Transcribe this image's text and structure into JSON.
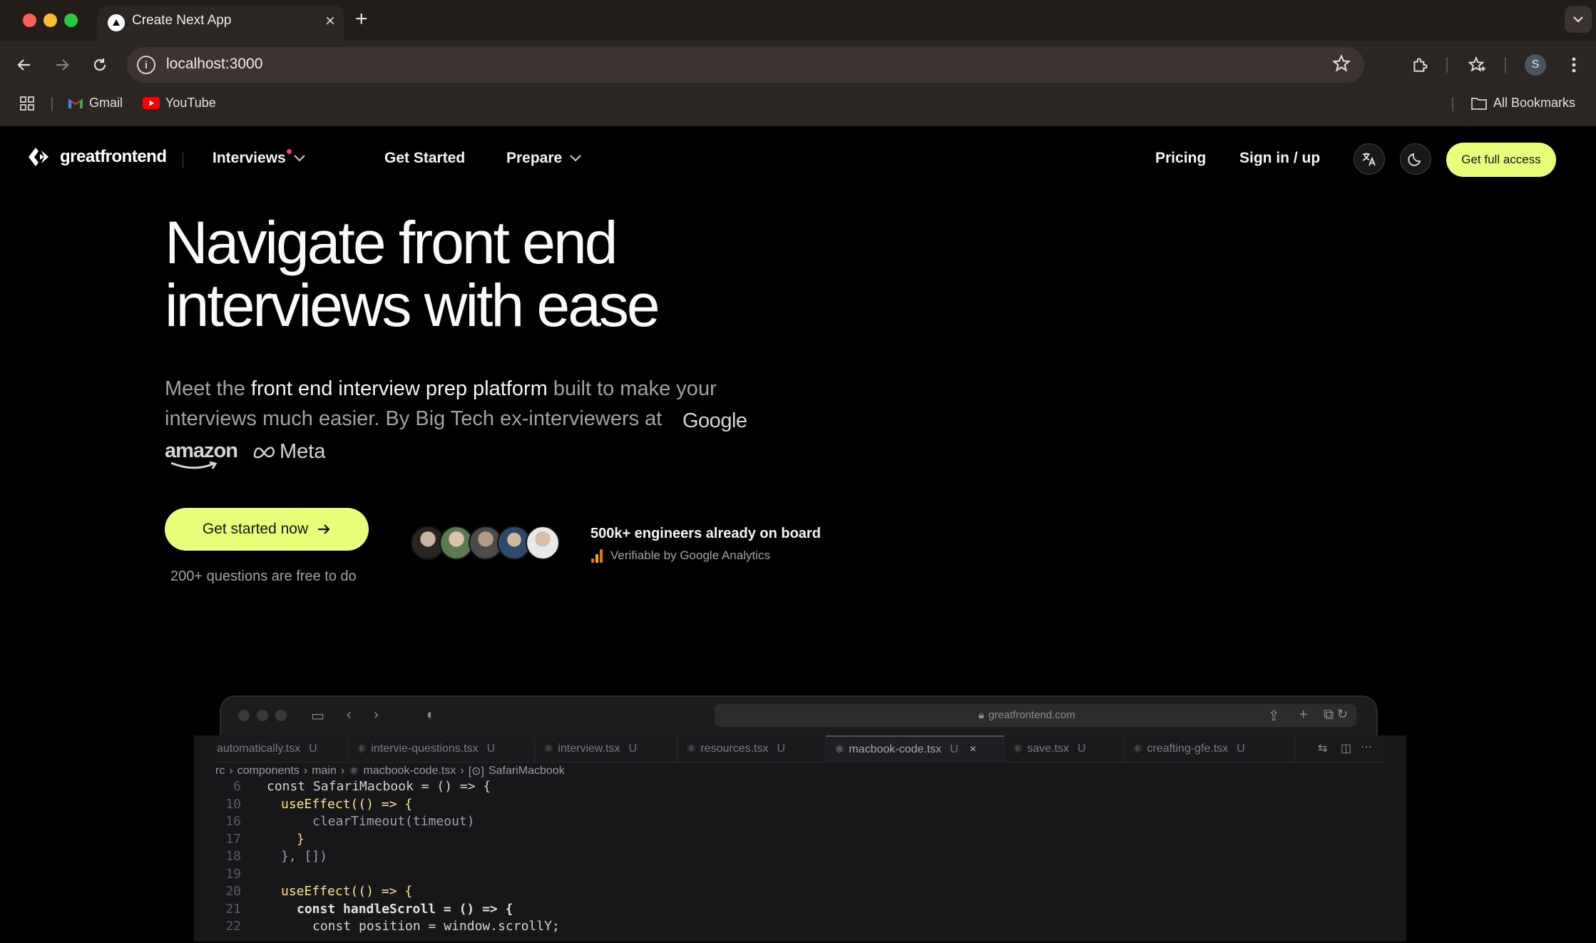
{
  "browser": {
    "tab_title": "Create Next App",
    "url": "localhost:3000",
    "profile_initial": "S",
    "bookmarks": [
      {
        "label": "Gmail",
        "icon": "gmail-icon"
      },
      {
        "label": "YouTube",
        "icon": "youtube-icon"
      }
    ],
    "all_bookmarks_label": "All Bookmarks"
  },
  "nav": {
    "logo_text": "greatfrontend",
    "interviews_label": "Interviews",
    "get_started_label": "Get Started",
    "prepare_label": "Prepare",
    "pricing_label": "Pricing",
    "sign_in_label": "Sign in / up",
    "cta_label": "Get full access"
  },
  "hero": {
    "title_line1": "Navigate front end",
    "title_line2": "interviews with ease",
    "subtitle_pre": "Meet the ",
    "subtitle_highlight": "front end interview prep platform",
    "subtitle_post": " built to make your interviews much easier. By Big Tech ex-interviewers at",
    "company_google": "Google",
    "company_amazon": "amazon",
    "company_meta": "Meta",
    "primary_cta": "Get started now",
    "free_note": "200+ questions are free to do",
    "social_proof": "500k+ engineers already on board",
    "verifiable": "Verifiable by Google Analytics"
  },
  "mock_browser": {
    "url": "greatfrontend.com",
    "tabs": [
      {
        "label": "automatically.tsx",
        "status": "U"
      },
      {
        "label": "intervie-questions.tsx",
        "status": "U"
      },
      {
        "label": "interview.tsx",
        "status": "U"
      },
      {
        "label": "resources.tsx",
        "status": "U"
      },
      {
        "label": "macbook-code.tsx",
        "status": "U"
      },
      {
        "label": "save.tsx",
        "status": "U"
      },
      {
        "label": "creafting-gfe.tsx",
        "status": "U"
      }
    ],
    "breadcrumb": [
      "rc",
      "components",
      "main",
      "macbook-code.tsx",
      "SafariMacbook"
    ],
    "code_lines": [
      {
        "n": "6",
        "text": "const SafariMacbook = () => {"
      },
      {
        "n": "10",
        "text": "useEffect(() => {"
      },
      {
        "n": "16",
        "text": "clearTimeout(timeout)"
      },
      {
        "n": "17",
        "text": "}"
      },
      {
        "n": "18",
        "text": "}, [])"
      },
      {
        "n": "19",
        "text": ""
      },
      {
        "n": "20",
        "text": "useEffect(() => {"
      },
      {
        "n": "21",
        "text": "const handleScroll = () => {"
      },
      {
        "n": "22",
        "text": "const position = window.scrollY;"
      }
    ]
  },
  "colors": {
    "accent": "#e9ff7a",
    "page_bg": "#000000",
    "chrome_bg": "#2b2623",
    "notification_dot": "#f43f5e"
  }
}
